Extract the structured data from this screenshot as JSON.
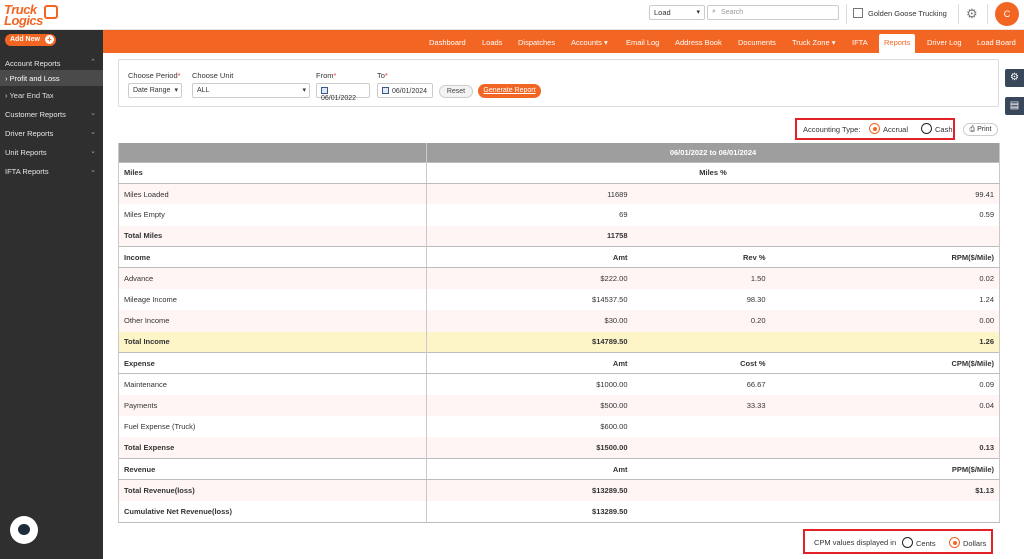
{
  "app": {
    "logo_line1": "Truck",
    "logo_line2": "Logics"
  },
  "topbar": {
    "search_type": "Load",
    "search_placeholder": "Search",
    "company_name": "Golden Goose Trucking",
    "avatar_initial": "C"
  },
  "sidebar": {
    "add_new_label": "Add New",
    "items": [
      {
        "label": "Account Reports"
      },
      {
        "label": "Profit and Loss"
      },
      {
        "label": "Year End Tax"
      },
      {
        "label": "Customer Reports"
      },
      {
        "label": "Driver Reports"
      },
      {
        "label": "Unit Reports"
      },
      {
        "label": "IFTA Reports"
      }
    ]
  },
  "nav": {
    "items": [
      "Dashboard",
      "Loads",
      "Dispatches",
      "Accounts",
      "Email Log",
      "Address Book",
      "Documents",
      "Truck Zone",
      "IFTA",
      "Reports",
      "Driver Log",
      "Load Board"
    ],
    "active": "Reports"
  },
  "filters": {
    "period_label": "Choose Period",
    "period_value": "Date Range",
    "unit_label": "Choose Unit",
    "unit_value": "ALL",
    "from_label": "From",
    "from_value": "06/01/2022",
    "to_label": "To",
    "to_value": "06/01/2024",
    "reset_label": "Reset",
    "generate_label": "Generate Report"
  },
  "accounting": {
    "label": "Accounting Type:",
    "option_accrual": "Accrual",
    "option_cash": "Cash",
    "selected": "Accrual",
    "print_label": "Print"
  },
  "report": {
    "period_header": "06/01/2022 to 06/01/2024",
    "miles": {
      "title": "Miles",
      "col_header": "Miles %",
      "rows": [
        {
          "label": "Miles Loaded",
          "value": "11689",
          "pct": "99.41"
        },
        {
          "label": "Miles Empty",
          "value": "69",
          "pct": "0.59"
        }
      ],
      "total_label": "Total Miles",
      "total_value": "11758"
    },
    "income": {
      "title": "Income",
      "amt_header": "Amt",
      "pct_header": "Rev %",
      "rate_header": "RPM($/Mile)",
      "rows": [
        {
          "label": "Advance",
          "amt": "$222.00",
          "pct": "1.50",
          "rate": "0.02"
        },
        {
          "label": "Mileage Income",
          "amt": "$14537.50",
          "pct": "98.30",
          "rate": "1.24"
        },
        {
          "label": "Other Income",
          "amt": "$30.00",
          "pct": "0.20",
          "rate": "0.00"
        }
      ],
      "total_label": "Total Income",
      "total_amt": "$14789.50",
      "total_rate": "1.26"
    },
    "expense": {
      "title": "Expense",
      "amt_header": "Amt",
      "pct_header": "Cost %",
      "rate_header": "CPM($/Mile)",
      "rows": [
        {
          "label": "Maintenance",
          "amt": "$1000.00",
          "pct": "66.67",
          "rate": "0.09"
        },
        {
          "label": "Payments",
          "amt": "$500.00",
          "pct": "33.33",
          "rate": "0.04"
        },
        {
          "label": "Fuel Expense (Truck)",
          "amt": "$600.00",
          "pct": "",
          "rate": ""
        }
      ],
      "total_label": "Total Expense",
      "total_amt": "$1500.00",
      "total_rate": "0.13"
    },
    "revenue": {
      "title": "Revenue",
      "amt_header": "Amt",
      "rate_header": "PPM($/Mile)",
      "total_label": "Total Revenue(loss)",
      "total_amt": "$13289.50",
      "total_rate": "$1.13",
      "cumulative_label": "Cumulative Net Revenue(loss)",
      "cumulative_amt": "$13289.50"
    }
  },
  "cpm": {
    "label": "CPM values displayed in",
    "option_cents": "Cents",
    "option_dollars": "Dollars",
    "selected": "Dollars"
  },
  "colors": {
    "accent": "#f26522",
    "sidebar": "#2f2f2f",
    "highlight_box": "#e32227"
  }
}
